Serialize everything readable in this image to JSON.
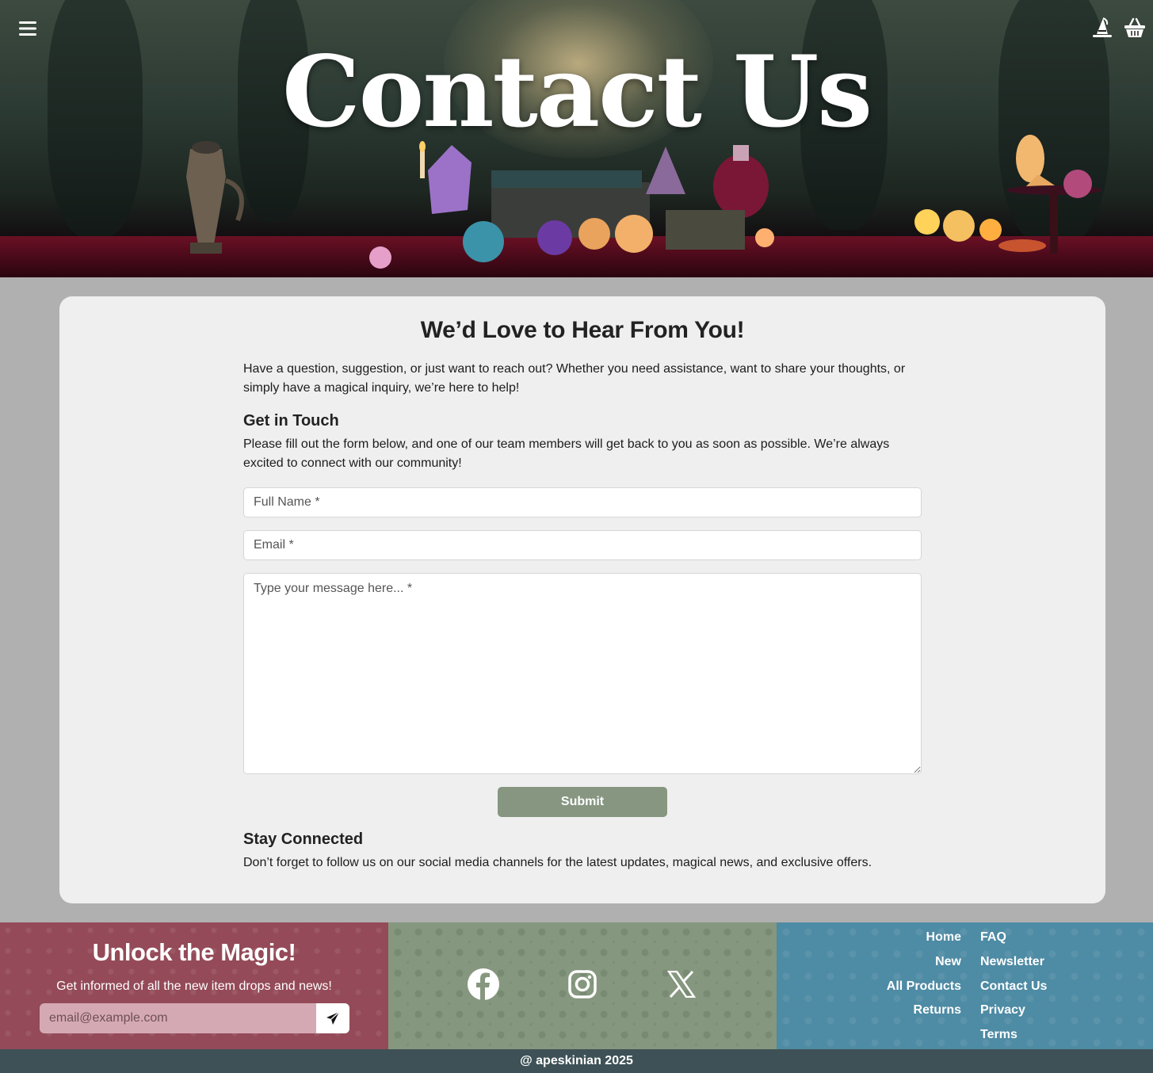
{
  "hero": {
    "title": "Contact Us",
    "menu_icon": "hamburger-menu-icon",
    "account_icon": "witch-hat-icon",
    "cart_icon": "basket-icon"
  },
  "main": {
    "heading": "We’d Love to Hear From You!",
    "intro": "Have a question, suggestion, or just want to reach out? Whether you need assistance, want to share your thoughts, or simply have a magical inquiry, we’re here to help!",
    "get_in_touch": {
      "heading": "Get in Touch",
      "text": "Please fill out the form below, and one of our team members will get back to you as soon as possible. We’re always excited to connect with our community!"
    },
    "form": {
      "name_placeholder": "Full Name *",
      "email_placeholder": "Email *",
      "message_placeholder": "Type your message here... *",
      "submit_label": "Submit"
    },
    "stay_connected": {
      "heading": "Stay Connected",
      "text": "Don’t forget to follow us on our social media channels for the latest updates, magical news, and exclusive offers."
    }
  },
  "footer": {
    "newsletter": {
      "title": "Unlock the Magic!",
      "subtitle": "Get informed of all the new item drops and news!",
      "email_placeholder": "email@example.com",
      "send_icon": "paper-plane-icon"
    },
    "social": [
      "facebook-icon",
      "instagram-icon",
      "x-icon"
    ],
    "links_left": [
      "Home",
      "New",
      "All Products",
      "Returns"
    ],
    "links_right": [
      "FAQ",
      "Newsletter",
      "Contact Us",
      "Privacy",
      "Terms"
    ],
    "copyright": "@ apeskinian 2025"
  },
  "colors": {
    "card_bg": "#efefef",
    "page_bg": "#b0b0b0",
    "submit": "#869680",
    "footer_rose": "#944a58",
    "footer_sage": "#86977f",
    "footer_teal": "#4e8ba4",
    "bottom_bar": "#3d5156"
  }
}
